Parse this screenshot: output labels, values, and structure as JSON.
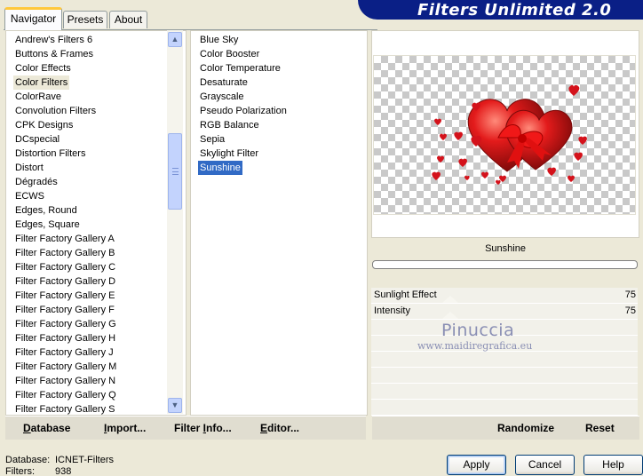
{
  "tabs": [
    "Navigator",
    "Presets",
    "About"
  ],
  "app_title": "Filters Unlimited 2.0",
  "categories": [
    "Andrew's Filters 6",
    "Buttons & Frames",
    "Color Effects",
    "Color Filters",
    "ColorRave",
    "Convolution Filters",
    "CPK Designs",
    "DCspecial",
    "Distortion Filters",
    "Distort",
    "Dégradés",
    "ECWS",
    "Edges, Round",
    "Edges, Square",
    "Filter Factory Gallery A",
    "Filter Factory Gallery B",
    "Filter Factory Gallery C",
    "Filter Factory Gallery D",
    "Filter Factory Gallery E",
    "Filter Factory Gallery F",
    "Filter Factory Gallery G",
    "Filter Factory Gallery H",
    "Filter Factory Gallery J",
    "Filter Factory Gallery M",
    "Filter Factory Gallery N",
    "Filter Factory Gallery Q",
    "Filter Factory Gallery S"
  ],
  "selected_category": "Color Filters",
  "filters": [
    "Blue Sky",
    "Color Booster",
    "Color Temperature",
    "Desaturate",
    "Grayscale",
    "Pseudo Polarization",
    "RGB Balance",
    "Sepia",
    "Skylight Filter",
    "Sunshine"
  ],
  "selected_filter": "Sunshine",
  "filter_name": "Sunshine",
  "params": [
    {
      "name": "Sunlight Effect",
      "value": "75"
    },
    {
      "name": "Intensity",
      "value": "75"
    }
  ],
  "watermark": {
    "line1": "Pinuccia",
    "line2": "www.maidiregrafica.eu"
  },
  "toolbar": {
    "database_key": "D",
    "database_rest": "atabase",
    "import_key": "I",
    "import_rest": "mport...",
    "filter_info_pre": "Filter ",
    "filter_info_key": "I",
    "filter_info_rest": "nfo...",
    "editor_key": "E",
    "editor_rest": "ditor...",
    "randomize": "Randomize",
    "reset": "Reset"
  },
  "footer": {
    "database_label": "Database:",
    "database_value": "ICNET-Filters",
    "filters_label": "Filters:",
    "filters_value": "938"
  },
  "buttons": {
    "apply": "Apply",
    "cancel": "Cancel",
    "help": "Help"
  },
  "scrollbar_position": 0.1,
  "colors": {
    "banner": "#0a1f86",
    "selection": "#316ac5",
    "hearts": "#d4121b"
  }
}
